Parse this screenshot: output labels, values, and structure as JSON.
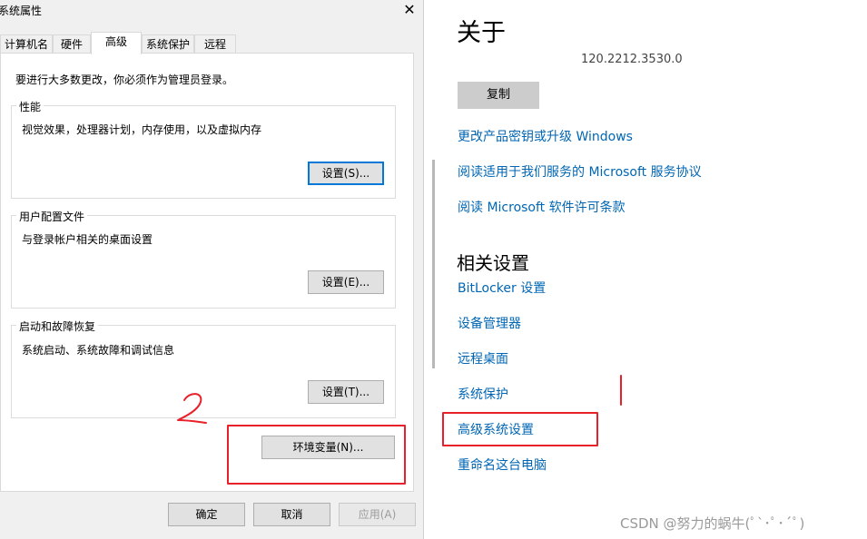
{
  "dialog": {
    "title": "系统属性",
    "close_glyph": "✕",
    "tabs": [
      {
        "label": "计算机名"
      },
      {
        "label": "硬件"
      },
      {
        "label": "高级"
      },
      {
        "label": "系统保护"
      },
      {
        "label": "远程"
      }
    ],
    "active_tab": "高级",
    "notice": "要进行大多数更改，你必须作为管理员登录。",
    "groups": {
      "performance": {
        "title": "性能",
        "desc": "视觉效果，处理器计划，内存使用，以及虚拟内存",
        "button": "设置(S)..."
      },
      "profiles": {
        "title": "用户配置文件",
        "desc": "与登录帐户相关的桌面设置",
        "button": "设置(E)..."
      },
      "startup": {
        "title": "启动和故障恢复",
        "desc": "系统启动、系统故障和调试信息",
        "button": "设置(T)..."
      }
    },
    "env_button": "环境变量(N)...",
    "footer": {
      "ok": "确定",
      "cancel": "取消",
      "apply": "应用(A)"
    }
  },
  "about": {
    "title": "关于",
    "version": "120.2212.3530.0",
    "copy_button": "复制",
    "links": [
      "更改产品密钥或升级 Windows",
      "阅读适用于我们服务的 Microsoft 服务协议",
      "阅读 Microsoft 软件许可条款"
    ],
    "related_title": "相关设置",
    "related_links": [
      "BitLocker 设置",
      "设备管理器",
      "远程桌面",
      "系统保护",
      "高级系统设置",
      "重命名这台电脑"
    ]
  },
  "annotations": {
    "color": "#e8202a",
    "mark_step2": "2"
  },
  "watermark": "CSDN @努力的蜗牛(ﾟ`･ﾟ･´ﾟ)"
}
